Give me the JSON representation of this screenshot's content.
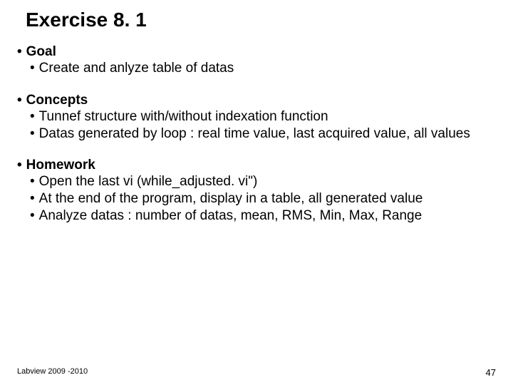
{
  "title": "Exercise 8. 1",
  "sections": [
    {
      "header": "Goal",
      "items": [
        "Create and anlyze table of datas"
      ]
    },
    {
      "header": "Concepts",
      "items": [
        "Tunnef structure with/without indexation function",
        "Datas generated by loop : real time value, last acquired value, all values"
      ]
    },
    {
      "header": "Homework",
      "items": [
        "Open the last vi (while_adjusted. vi\")",
        "At the end of the program, display in a table, all generated value",
        "Analyze datas : number of datas, mean, RMS, Min, Max, Range"
      ]
    }
  ],
  "footer": {
    "left": "Labview 2009 -2010",
    "right": "47"
  }
}
